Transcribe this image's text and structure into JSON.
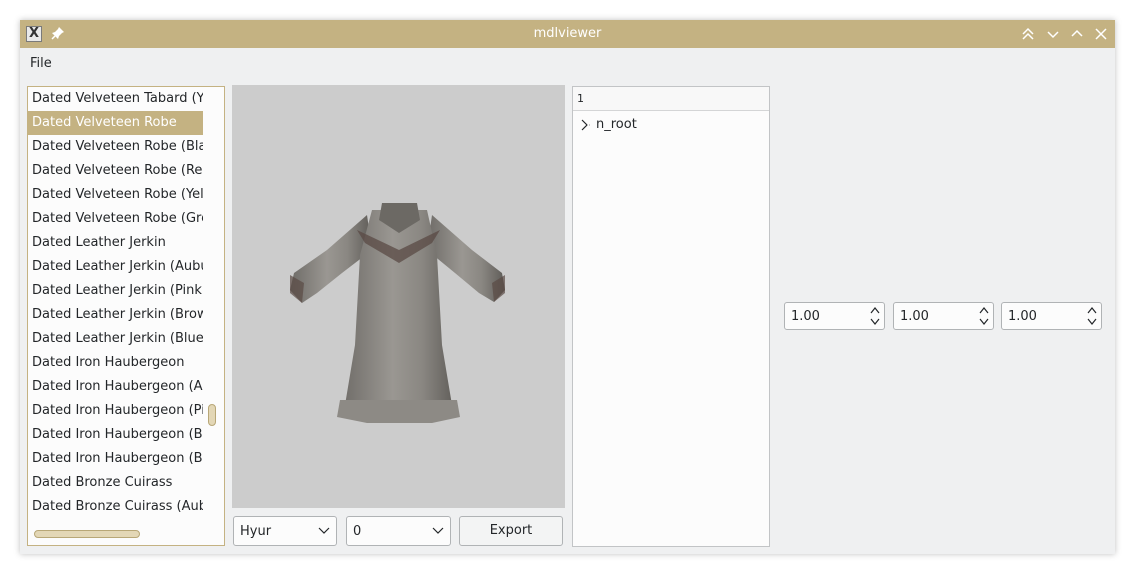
{
  "window": {
    "title": "mdlviewer"
  },
  "menu": {
    "file": "File"
  },
  "item_list": [
    "Dated Velveteen Tabard (Yell",
    "Dated Velveteen Robe",
    "Dated Velveteen Robe (Black",
    "Dated Velveteen Robe (Red)",
    "Dated Velveteen Robe (Yellov",
    "Dated Velveteen Robe (Greer",
    "Dated Leather Jerkin",
    "Dated Leather Jerkin (Aubur",
    "Dated Leather Jerkin (Pink)",
    "Dated Leather Jerkin (Brown",
    "Dated Leather Jerkin (Blue)",
    "Dated Iron Haubergeon",
    "Dated Iron Haubergeon (Aub",
    "Dated Iron Haubergeon (Pin",
    "Dated Iron Haubergeon (Bro",
    "Dated Iron Haubergeon (Blu",
    "Dated Bronze Cuirass",
    "Dated Bronze Cuirass (Aubur"
  ],
  "selected_index": 1,
  "controls": {
    "race": "Hyur",
    "variant": "0",
    "export": "Export"
  },
  "tree": {
    "header": "1",
    "root": "n_root"
  },
  "scale": {
    "x": "1.00",
    "y": "1.00",
    "z": "1.00"
  },
  "colors": {
    "accent": "#c4b282",
    "viewport": "#cccccc"
  }
}
